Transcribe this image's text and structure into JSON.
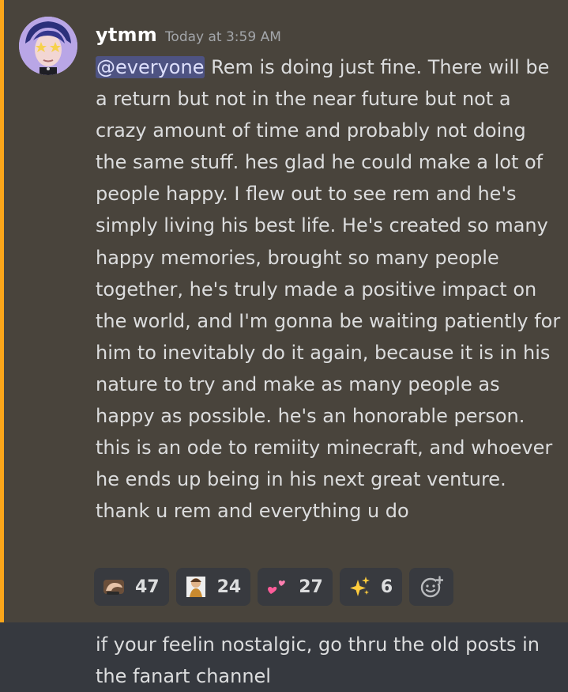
{
  "message": {
    "author": "ytmm",
    "timestamp": "Today at 3:59 AM",
    "mention": "@everyone",
    "body": " Rem is doing just fine. There will be a return but not in the near future but not a crazy amount of time and probably not doing the same stuff. hes glad he could make a lot of people happy. I flew out to see rem and he's simply living his best life. He's created so many happy memories, brought so many people together, he's truly made a positive impact on the world, and I'm gonna be waiting patiently for him to inevitably do it again, because it is in his nature to try and make as many people as happy as possible. he's an honorable person. this is an ode to remiity minecraft, and whoever he ends up being in his next great venture. thank u rem and everything u do",
    "mention_bar_color": "#faa61a"
  },
  "reactions": [
    {
      "icon": "custom-emoji-hand-icon",
      "count": "47"
    },
    {
      "icon": "custom-emoji-person-icon",
      "count": "24"
    },
    {
      "icon": "two-hearts-icon",
      "count": "27"
    },
    {
      "icon": "sparkles-icon",
      "count": "6"
    }
  ],
  "add_reaction_icon": "add-reaction-icon",
  "next_message": {
    "body": "if your feelin nostalgic, go thru the old posts in the fanart channel"
  }
}
